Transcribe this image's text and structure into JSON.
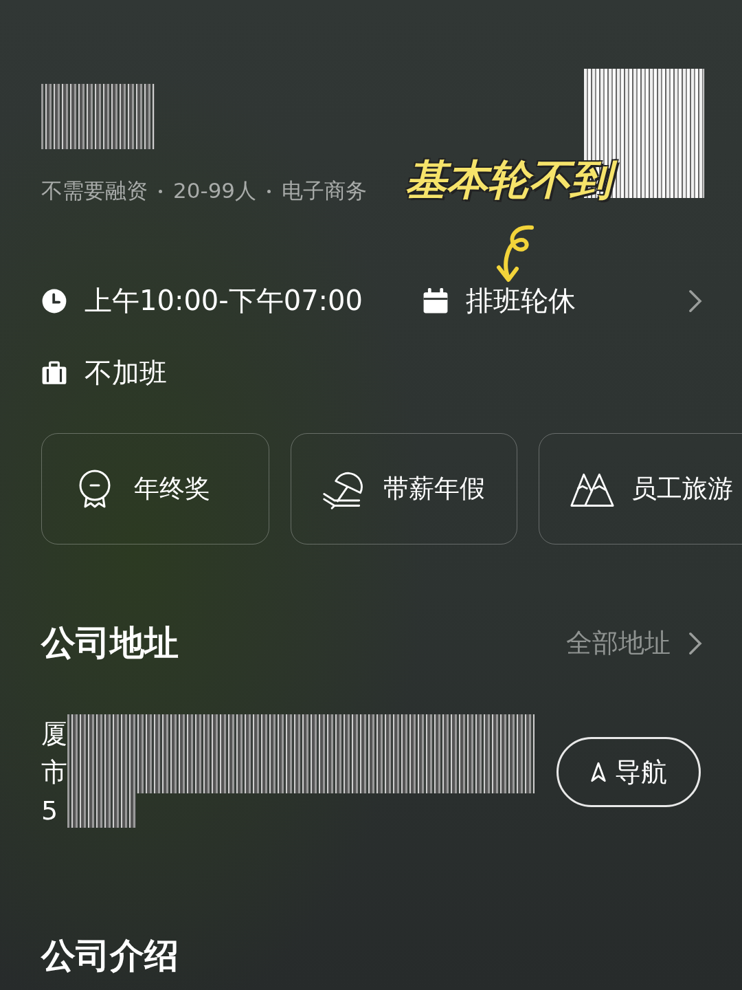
{
  "company": {
    "tags": [
      "不需要融资",
      "20-99人",
      "电子商务"
    ]
  },
  "annotation": {
    "text": "基本轮不到"
  },
  "work_info": [
    {
      "kind": "hours",
      "text": "上午10:00-下午07:00"
    },
    {
      "kind": "schedule",
      "text": "排班轮休"
    },
    {
      "kind": "overtime",
      "text": "不加班"
    }
  ],
  "benefits": [
    {
      "kind": "bonus",
      "label": "年终奖"
    },
    {
      "kind": "vacation",
      "label": "带薪年假"
    },
    {
      "kind": "travel",
      "label": "员工旅游"
    }
  ],
  "address_section": {
    "title": "公司地址",
    "link": "全部地址",
    "address_lines": [
      "厦",
      "市",
      "5"
    ],
    "nav_button": "导航"
  },
  "intro_section": {
    "title": "公司介绍"
  }
}
